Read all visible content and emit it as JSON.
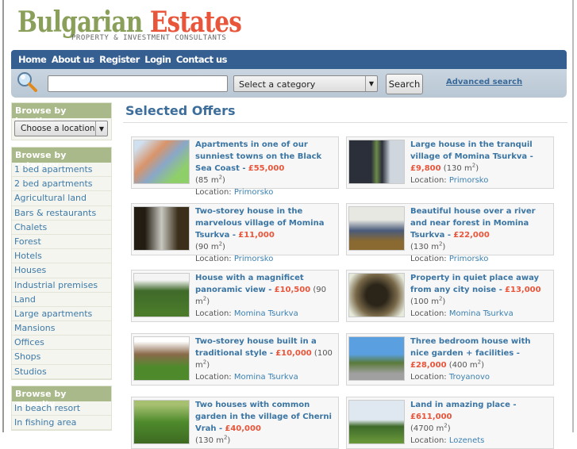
{
  "logo": {
    "word1": "Bulgarian",
    "word2": "Estates",
    "tagline": "PROPERTY & INVESTMENT CONSULTANTS"
  },
  "nav": [
    "Home",
    "About us",
    "Register",
    "Login",
    "Contact us"
  ],
  "search": {
    "value": "",
    "category": "Select a category",
    "button": "Search",
    "advanced": "Advanced search"
  },
  "sidebar": {
    "location": {
      "title": "Browse by location",
      "select": "Choose a location"
    },
    "category": {
      "title": "Browse by category",
      "items": [
        "1 bed apartments",
        "2 bed apartments",
        "Agricultural land",
        "Bars & restaurants",
        "Chalets",
        "Forest",
        "Hotels",
        "Houses",
        "Industrial premises",
        "Land",
        "Large apartments",
        "Mansions",
        "Offices",
        "Shops",
        "Studios"
      ]
    },
    "amenity": {
      "title": "Browse by amenity",
      "items": [
        "In beach resort",
        "In fishing area"
      ]
    }
  },
  "main": {
    "title": "Selected Offers",
    "location_label": "Location:",
    "area_unit": "m",
    "offers": [
      {
        "title": "Apartments in one of our sunniest towns on the Black Sea Coast -",
        "price": "£55,000",
        "area": "85",
        "location": "Primorsko",
        "br": true
      },
      {
        "title": "Large house in the tranquil village of Momina Tsurkva -",
        "price": "£9,800",
        "area": "130",
        "location": "Primorsko"
      },
      {
        "title": "Two-storey house in the marvelous village of Momina Tsurkva -",
        "price": "£11,000",
        "area": "90",
        "location": "Primorsko",
        "br": true
      },
      {
        "title": "Beautiful house over a river and near forest in Momina Tsurkva -",
        "price": "£22,000",
        "area": "130",
        "location": "Primorsko",
        "br": true
      },
      {
        "title": "House with a magnificet panoramic view -",
        "price": "£10,500",
        "area": "90",
        "location": "Momina Tsurkva"
      },
      {
        "title": "Property in quiet place away from any city noise -",
        "price": "£13,000",
        "area": "100",
        "location": "Momina Tsurkva"
      },
      {
        "title": "Two-storey house built in a traditional style -",
        "price": "£10,000",
        "area": "100",
        "location": "Momina Tsurkva"
      },
      {
        "title": "Three bedroom house with nice garden + facilities -",
        "price": "£28,000",
        "area": "400",
        "location": "Troyanovo"
      },
      {
        "title": "Two houses with common garden in the village of Cherni Vrah -",
        "price": "£40,000",
        "area": "130",
        "location": "",
        "br": true
      },
      {
        "title": "Land in amazing place -",
        "price": "£611,000",
        "area": "4700",
        "location": "Lozenets",
        "br": true
      }
    ]
  }
}
